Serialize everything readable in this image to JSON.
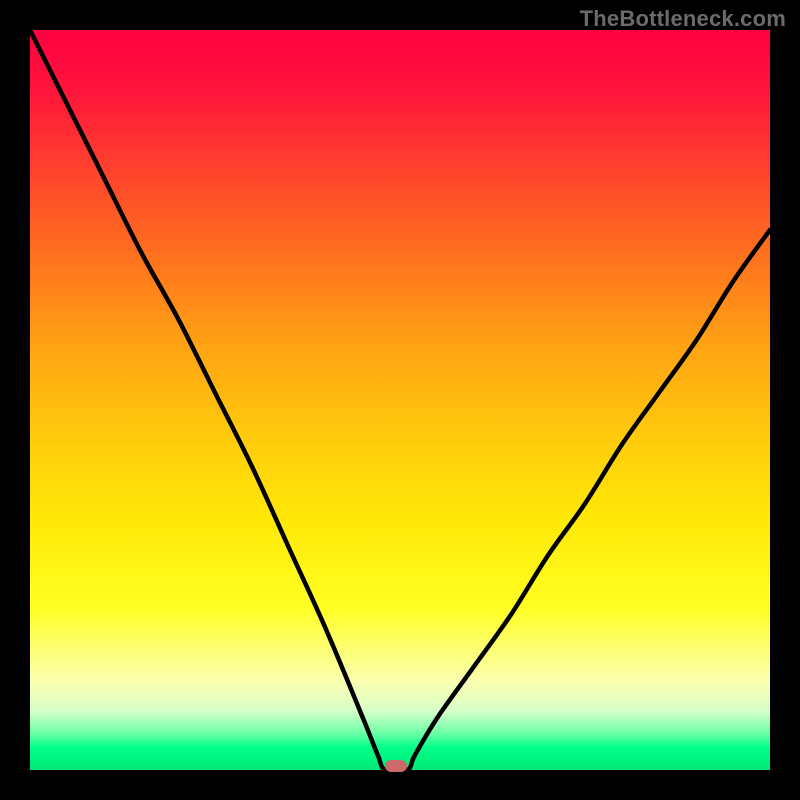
{
  "watermark": "TheBottleneck.com",
  "colors": {
    "frame_bg": "#000000",
    "gradient_top": "#ff0040",
    "gradient_bottom": "#00e878",
    "curve_stroke": "#000000",
    "marker_fill": "#cc6a6a",
    "watermark_color": "#6b6b6b"
  },
  "chart_data": {
    "type": "line",
    "title": "",
    "xlabel": "",
    "ylabel": "",
    "xlim": [
      0,
      100
    ],
    "ylim": [
      0,
      100
    ],
    "x": [
      0,
      5,
      10,
      15,
      20,
      25,
      30,
      35,
      40,
      45,
      47,
      48,
      51,
      52,
      55,
      60,
      65,
      70,
      75,
      80,
      85,
      90,
      95,
      100
    ],
    "values": [
      100,
      90,
      80,
      70,
      61,
      51,
      41,
      30,
      19,
      7,
      2,
      0,
      0,
      2,
      7,
      14,
      21,
      29,
      36,
      44,
      51,
      58,
      66,
      73
    ],
    "marker": {
      "x": 49.5,
      "y": 0
    },
    "grid": false,
    "legend": false
  }
}
